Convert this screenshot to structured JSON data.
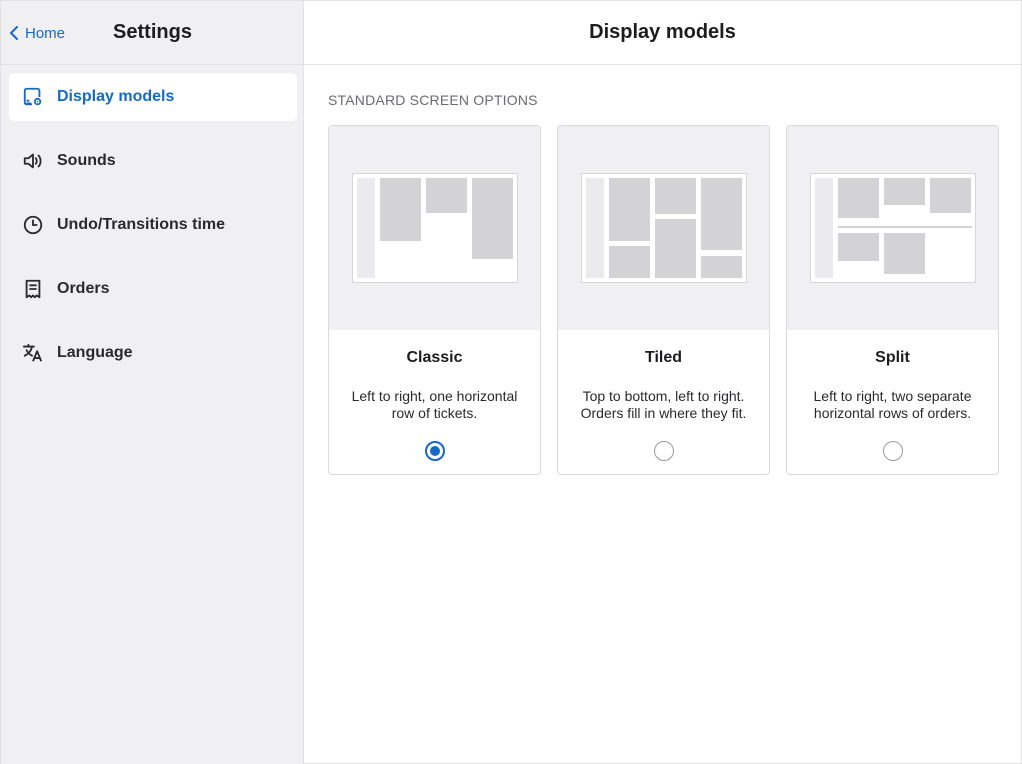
{
  "sidebar": {
    "back_label": "Home",
    "title": "Settings",
    "items": [
      {
        "label": "Display models",
        "icon": "display-settings-icon",
        "active": true
      },
      {
        "label": "Sounds",
        "icon": "speaker-icon",
        "active": false
      },
      {
        "label": "Undo/Transitions time",
        "icon": "clock-icon",
        "active": false
      },
      {
        "label": "Orders",
        "icon": "receipt-icon",
        "active": false
      },
      {
        "label": "Language",
        "icon": "translate-icon",
        "active": false
      }
    ]
  },
  "main": {
    "title": "Display models",
    "section_label": "STANDARD SCREEN OPTIONS",
    "options": [
      {
        "title": "Classic",
        "description": "Left to right, one horizontal row of tickets.",
        "selected": true
      },
      {
        "title": "Tiled",
        "description": "Top to bottom, left to right. Orders fill in where they fit.",
        "selected": false
      },
      {
        "title": "Split",
        "description": "Left to right, two separate horizontal rows of orders.",
        "selected": false
      }
    ]
  },
  "colors": {
    "accent": "#1769c6",
    "sidebar_bg": "#f0f0f2",
    "preview_block": "#d3d3d6"
  }
}
